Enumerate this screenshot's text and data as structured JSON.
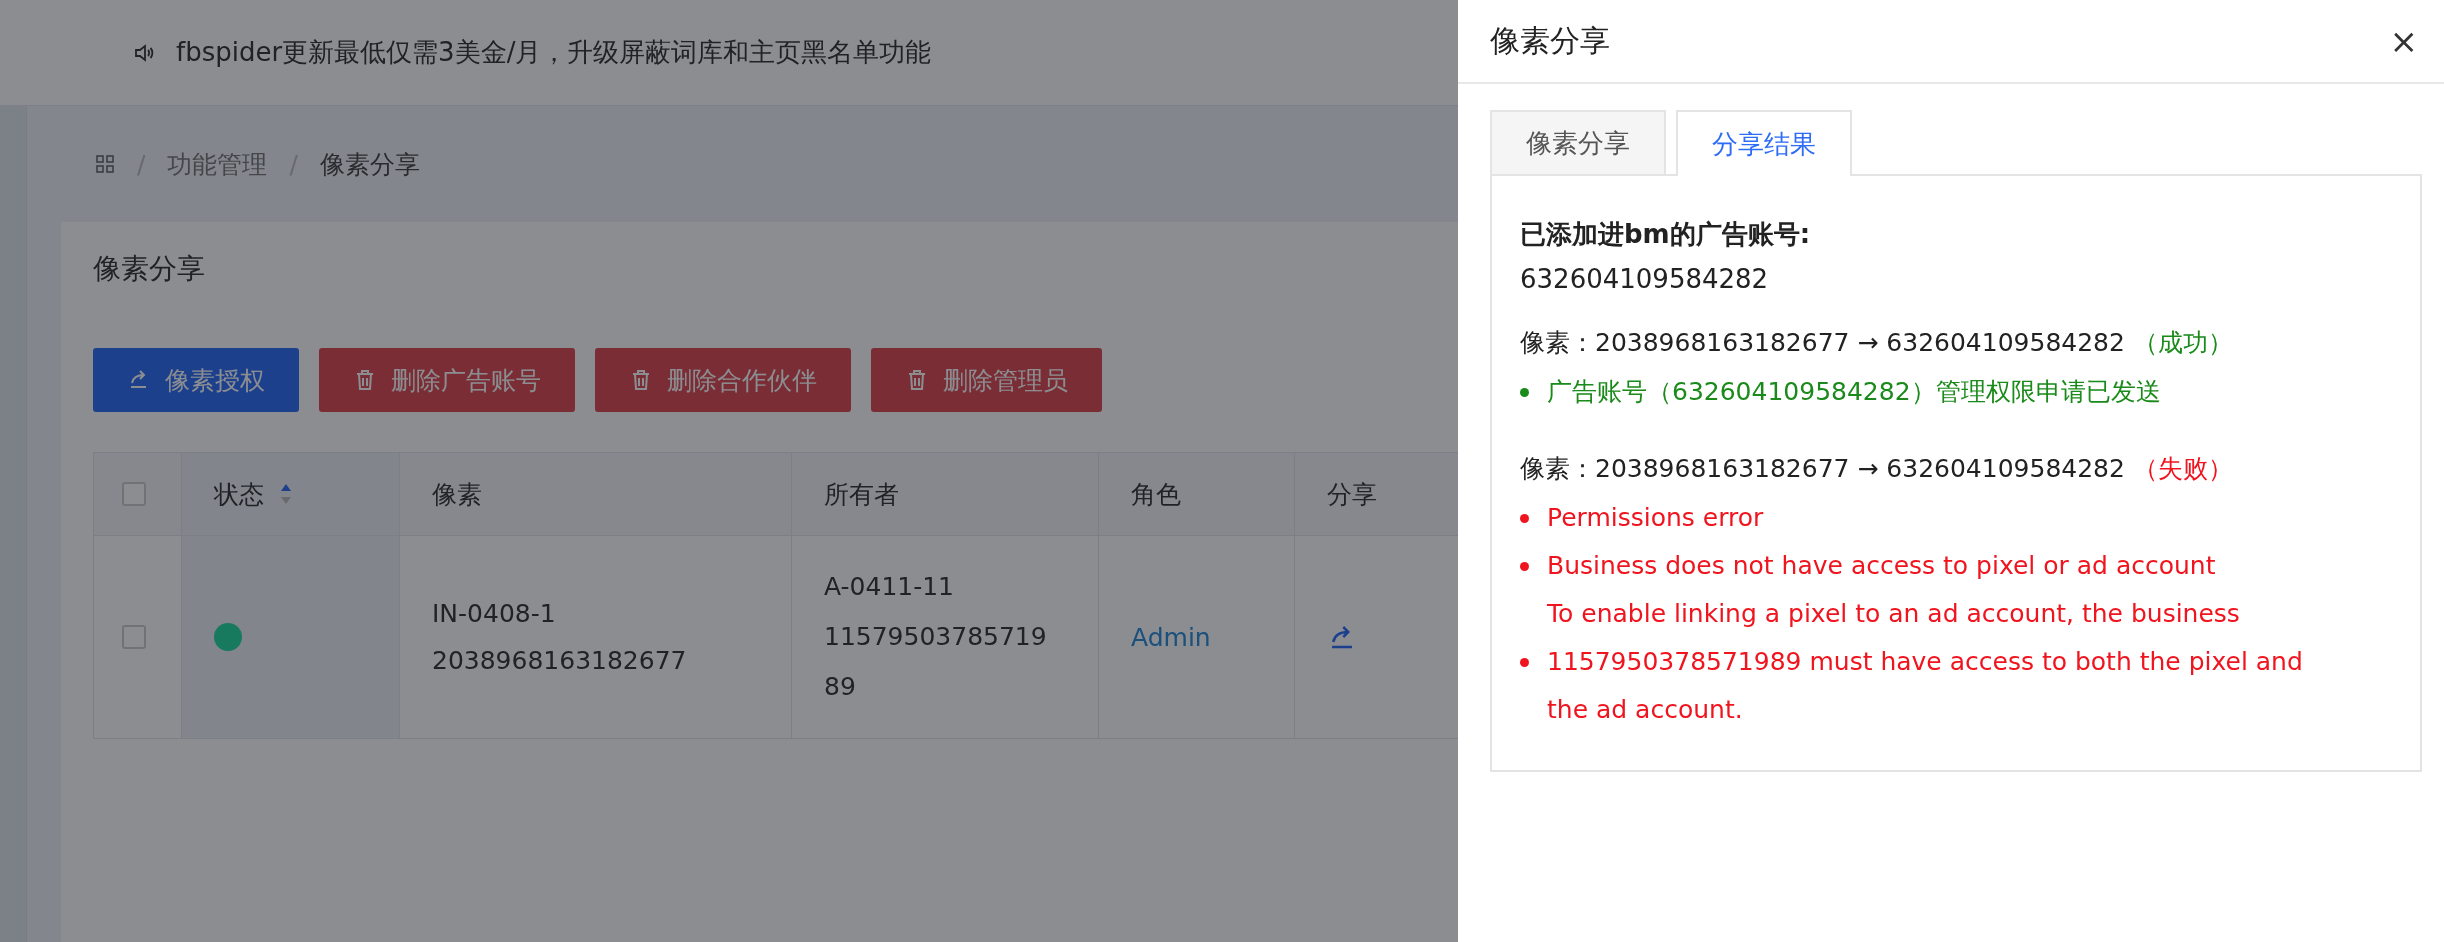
{
  "announcement": {
    "text": "fbspider更新最低仅需3美金/月，升级屏蔽词库和主页黑名单功能"
  },
  "breadcrumb": {
    "separator": "/",
    "items": [
      "功能管理",
      "像素分享"
    ]
  },
  "card": {
    "title": "像素分享"
  },
  "toolbar": [
    {
      "label": "像素授权",
      "kind": "primary"
    },
    {
      "label": "删除广告账号",
      "kind": "danger"
    },
    {
      "label": "删除合作伙伴",
      "kind": "danger"
    },
    {
      "label": "删除管理员",
      "kind": "danger"
    }
  ],
  "table": {
    "header_checked": false,
    "columns": [
      {
        "label": "状态",
        "sorted": true
      },
      {
        "label": "像素",
        "sorted": false
      },
      {
        "label": "所有者",
        "sorted": false
      },
      {
        "label": "角色",
        "sorted": false
      },
      {
        "label": "分享",
        "sorted": false
      }
    ],
    "rows": [
      {
        "checked": false,
        "color": "#177a5e",
        "pixel": [
          "IN-0408-1",
          "2038968163182677"
        ],
        "owner": [
          "A-0411-11",
          "1157950378571989"
        ],
        "role": "Admin"
      }
    ]
  },
  "drawer": {
    "title": "像素分享",
    "close": "×",
    "tabs": [
      {
        "label": "像素分享",
        "selected": false
      },
      {
        "label": "分享结果",
        "selected": true
      }
    ],
    "heading": "已添加进bm的广告账号:",
    "accounts": [
      "632604109584282"
    ],
    "entries": [
      {
        "label": "像素：",
        "pixel": "2038968163182677",
        "arrow": "→",
        "account": "632604109584282",
        "status": "（成功）",
        "success": true,
        "messages": [
          {
            "lines": [
              "广告账号（632604109584282）管理权限申请已发送"
            ]
          }
        ]
      },
      {
        "label": "像素：",
        "pixel": "2038968163182677",
        "arrow": "→",
        "account": "632604109584282",
        "status": "（失败）",
        "success": false,
        "messages": [
          {
            "lines": [
              "Permissions error"
            ]
          },
          {
            "lines": [
              "Business does not have access to pixel or ad account",
              "To enable linking a pixel to an ad account, the business"
            ]
          },
          {
            "lines": [
              "1157950378571989 must have access to both the pixel and",
              "the ad account."
            ]
          }
        ]
      }
    ]
  }
}
